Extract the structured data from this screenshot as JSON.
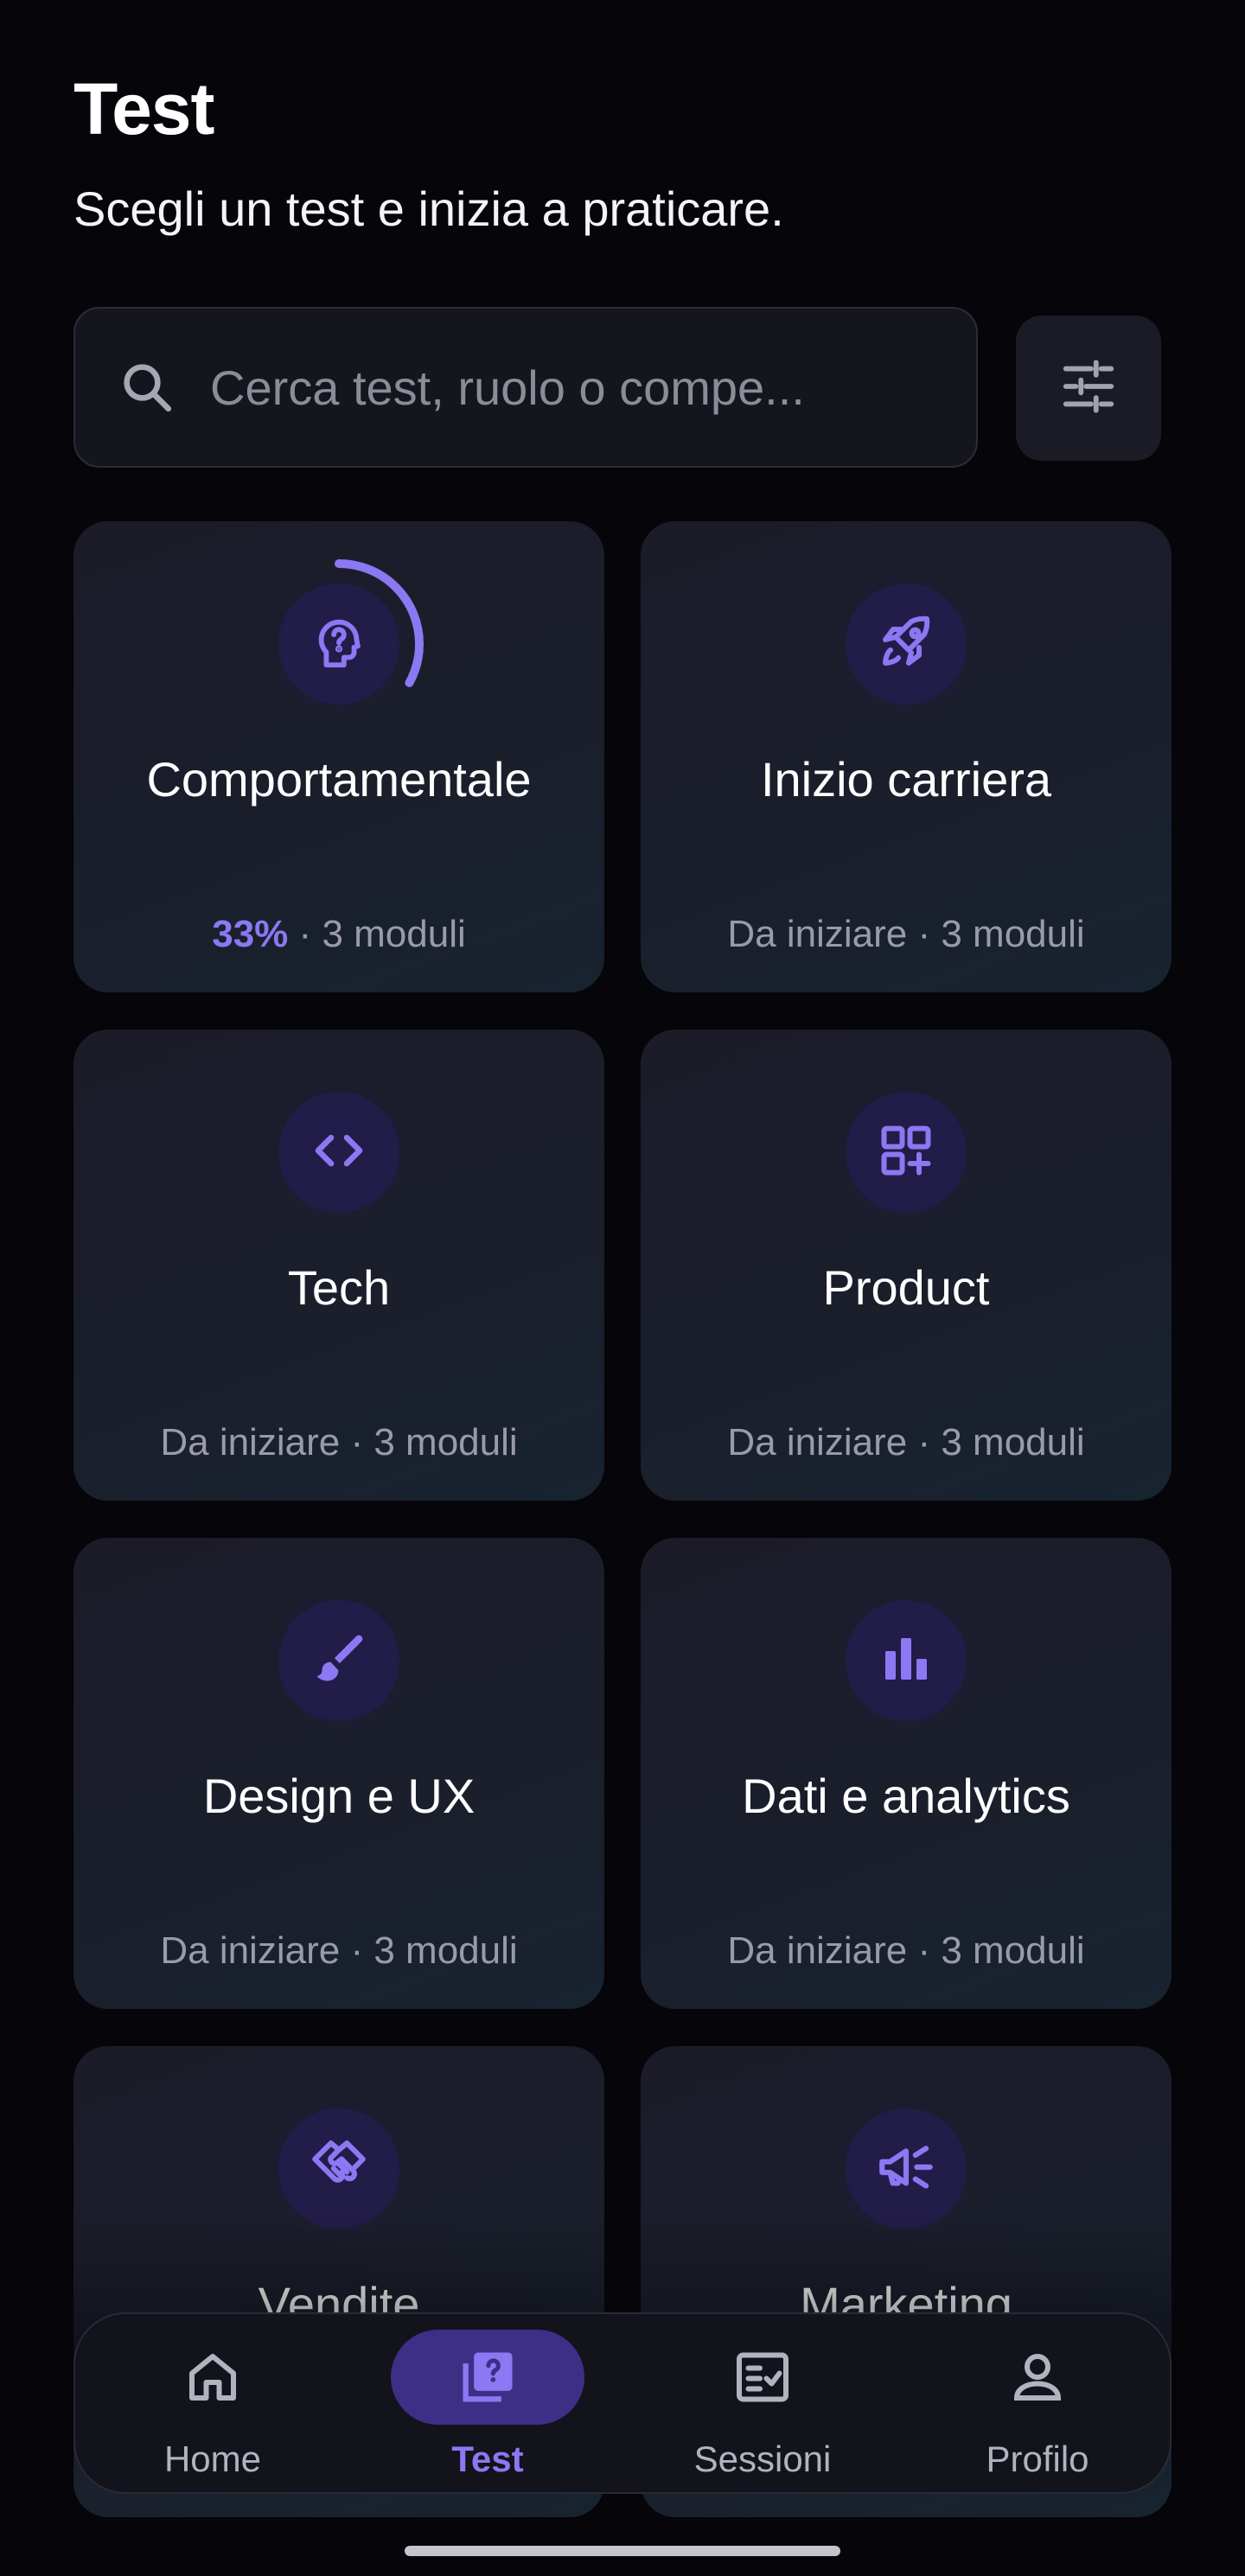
{
  "header": {
    "title": "Test",
    "subtitle": "Scegli un test e inizia a praticare."
  },
  "search": {
    "placeholder": "Cerca test, ruolo o compe...",
    "value": ""
  },
  "filter": {
    "icon": "sliders-icon"
  },
  "cards": [
    {
      "title": "Comportamentale",
      "progress_label": "33%",
      "progress": 0.33,
      "separator": "·",
      "modules": "3 moduli",
      "icon": "head-question-icon"
    },
    {
      "title": "Inizio carriera",
      "status": "Da iniziare",
      "separator": "·",
      "modules": "3 moduli",
      "icon": "rocket-icon"
    },
    {
      "title": "Tech",
      "status": "Da iniziare",
      "separator": "·",
      "modules": "3 moduli",
      "icon": "code-icon"
    },
    {
      "title": "Product",
      "status": "Da iniziare",
      "separator": "·",
      "modules": "3 moduli",
      "icon": "grid-plus-icon"
    },
    {
      "title": "Design e UX",
      "status": "Da iniziare",
      "separator": "·",
      "modules": "3 moduli",
      "icon": "brush-icon"
    },
    {
      "title": "Dati e analytics",
      "status": "Da iniziare",
      "separator": "·",
      "modules": "3 moduli",
      "icon": "bar-chart-icon"
    },
    {
      "title": "Vendite",
      "icon": "handshake-icon"
    },
    {
      "title": "Marketing",
      "icon": "megaphone-icon"
    }
  ],
  "nav": {
    "items": [
      {
        "label": "Home",
        "icon": "home-icon",
        "active": false
      },
      {
        "label": "Test",
        "icon": "quiz-icon",
        "active": true
      },
      {
        "label": "Sessioni",
        "icon": "checklist-icon",
        "active": false
      },
      {
        "label": "Profilo",
        "icon": "person-icon",
        "active": false
      }
    ]
  },
  "colors": {
    "accent": "#8b78f2",
    "background": "#05050a",
    "card": "#1c1c29",
    "icon_bg": "#221c48",
    "muted_text": "#9b9ba8"
  }
}
